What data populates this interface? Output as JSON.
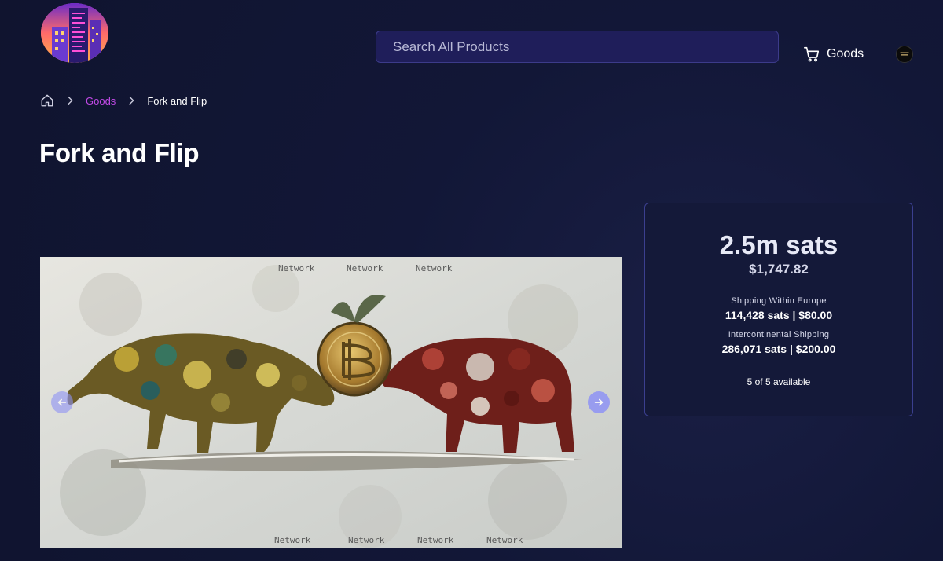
{
  "header": {
    "logo_icon": "city-skyline-logo-icon",
    "search": {
      "placeholder": "Search All Products",
      "value": ""
    },
    "cart": {
      "icon": "shopping-cart-icon",
      "label": "Goods"
    },
    "avatar": {
      "icon": "user-avatar-icon"
    }
  },
  "breadcrumb": {
    "home_icon": "home-icon",
    "items": [
      {
        "label": "Goods"
      },
      {
        "label": "Fork and Flip"
      }
    ]
  },
  "product": {
    "title": "Fork and Flip",
    "gallery": {
      "prev_icon": "arrow-left-icon",
      "next_icon": "arrow-right-icon",
      "image_texts": [
        "Network",
        "Network",
        "Network",
        "Network",
        "Network",
        "Network",
        "Network"
      ]
    }
  },
  "price": {
    "sats": "2.5m sats",
    "usd": "$1,747.82",
    "shipping": [
      {
        "label": "Shipping Within Europe",
        "value": "114,428 sats | $80.00"
      },
      {
        "label": "Intercontinental Shipping",
        "value": "286,071 sats | $200.00"
      }
    ],
    "availability": "5 of 5 available"
  },
  "colors": {
    "background": "#111633",
    "accent": "#c14ae6",
    "search_bg": "#1f1e5a",
    "card_border": "#3b3f8f",
    "nav_button": "#8f93f5"
  }
}
